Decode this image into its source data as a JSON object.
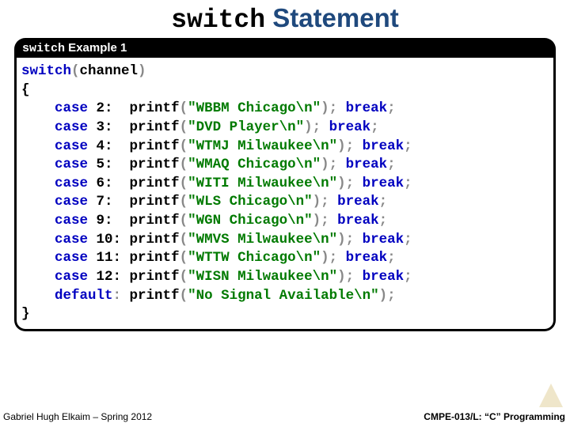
{
  "title": {
    "code": "switch",
    "plain": " Statement"
  },
  "box_header": {
    "mono": "switch",
    "rest": " Example 1"
  },
  "code": {
    "switch_expr_open": "switch",
    "channel": "channel",
    "lbrace": "{",
    "rbrace": "}",
    "cases": [
      {
        "n": "2",
        "fn": "printf",
        "str": "\"WBBM Chicago\\n\"",
        "brk": true
      },
      {
        "n": "3",
        "fn": "printf",
        "str": "\"DVD Player\\n\"",
        "brk": true
      },
      {
        "n": "4",
        "fn": "printf",
        "str": "\"WTMJ Milwaukee\\n\"",
        "brk": true
      },
      {
        "n": "5",
        "fn": "printf",
        "str": "\"WMAQ Chicago\\n\"",
        "brk": true
      },
      {
        "n": "6",
        "fn": "printf",
        "str": "\"WITI Milwaukee\\n\"",
        "brk": true
      },
      {
        "n": "7",
        "fn": "printf",
        "str": "\"WLS Chicago\\n\"",
        "brk": true
      },
      {
        "n": "9",
        "fn": "printf",
        "str": "\"WGN Chicago\\n\"",
        "brk": true
      },
      {
        "n": "10",
        "fn": "printf",
        "str": "\"WMVS Milwaukee\\n\"",
        "brk": true
      },
      {
        "n": "11",
        "fn": "printf",
        "str": "\"WTTW Chicago\\n\"",
        "brk": true
      },
      {
        "n": "12",
        "fn": "printf",
        "str": "\"WISN Milwaukee\\n\"",
        "brk": true
      }
    ],
    "default_fn": "printf",
    "default_str": "\"No Signal Available\\n\""
  },
  "footer": {
    "left": "Gabriel Hugh Elkaim – Spring 2012",
    "right": "CMPE-013/L: “C” Programming"
  }
}
